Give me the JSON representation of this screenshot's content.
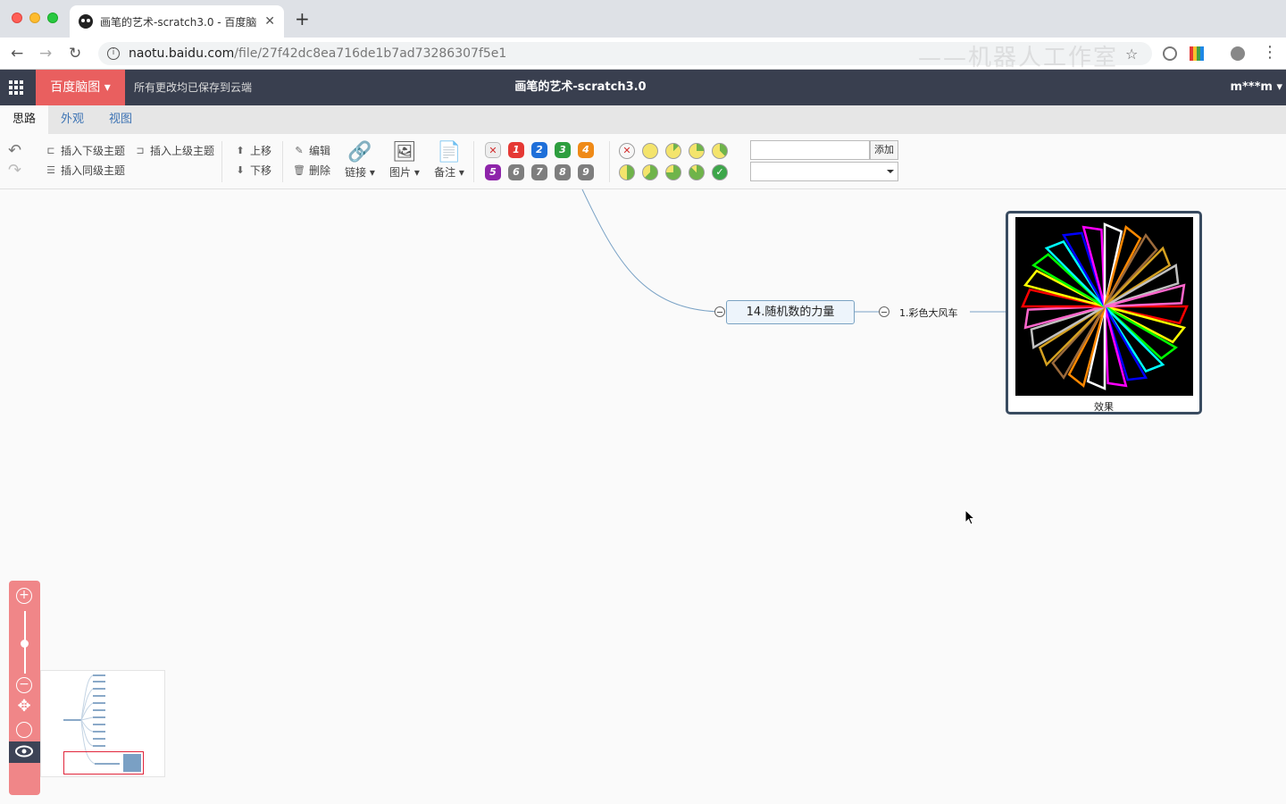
{
  "browser": {
    "tab_title": "画笔的艺术-scratch3.0 - 百度脑",
    "url_host": "naotu.baidu.com",
    "url_path": "/file/27f42dc8ea716de1b7ad73286307f5e1",
    "watermark": "——机器人工作室"
  },
  "header": {
    "brand": "百度脑图",
    "save_status": "所有更改均已保存到云端",
    "title": "画笔的艺术-scratch3.0",
    "user": "m***m"
  },
  "tabs": [
    {
      "label": "思路",
      "active": true
    },
    {
      "label": "外观",
      "active": false
    },
    {
      "label": "视图",
      "active": false
    }
  ],
  "toolbar": {
    "insert_child": "插入下级主题",
    "insert_parent": "插入上级主题",
    "insert_sibling": "插入同级主题",
    "move_up": "上移",
    "move_down": "下移",
    "edit": "编辑",
    "delete": "删除",
    "link": "链接",
    "image": "图片",
    "note": "备注",
    "tag_add": "添加",
    "priorities": [
      "1",
      "2",
      "3",
      "4",
      "5",
      "6",
      "7",
      "8",
      "9"
    ],
    "priority_colors": [
      "#e53935",
      "#1e6fd9",
      "#2e9e3f",
      "#ef8a17",
      "#8e24aa",
      "#7e7e7e",
      "#7e7e7e",
      "#7e7e7e",
      "#7e7e7e"
    ]
  },
  "mindmap": {
    "main_node": "14.随机数的力量",
    "sub_node": "1.彩色大风车",
    "image_caption": "效果"
  },
  "icons": {
    "zoom_in": "plus-circle-icon",
    "zoom_out": "minus-circle-icon",
    "move": "move-arrows-icon",
    "locate": "target-icon",
    "outline": "eye-icon"
  }
}
